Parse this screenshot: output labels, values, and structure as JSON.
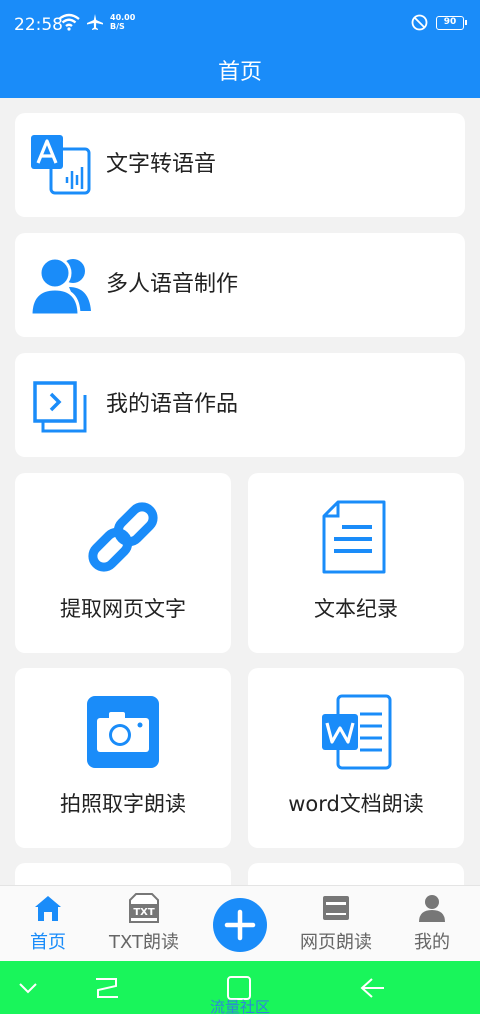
{
  "status_bar": {
    "time": "22:58",
    "net_speed_value": "40.00",
    "net_speed_unit": "B/S",
    "battery": "90"
  },
  "header": {
    "title": "首页"
  },
  "menu": {
    "text_to_speech": "文字转语音",
    "multi_voice": "多人语音制作",
    "my_works": "我的语音作品",
    "extract_web_text": "提取网页文字",
    "text_record": "文本纪录",
    "photo_read": "拍照取字朗读",
    "word_read": "word文档朗读"
  },
  "tabbar": {
    "home": "首页",
    "txt_read": "TXT朗读",
    "txt_icon_text": "TXT",
    "web_read": "网页朗读",
    "mine": "我的"
  },
  "watermark": "流量社区",
  "colors": {
    "accent": "#1a8cf9",
    "nav_green": "#19f55b",
    "inactive": "#777777"
  }
}
